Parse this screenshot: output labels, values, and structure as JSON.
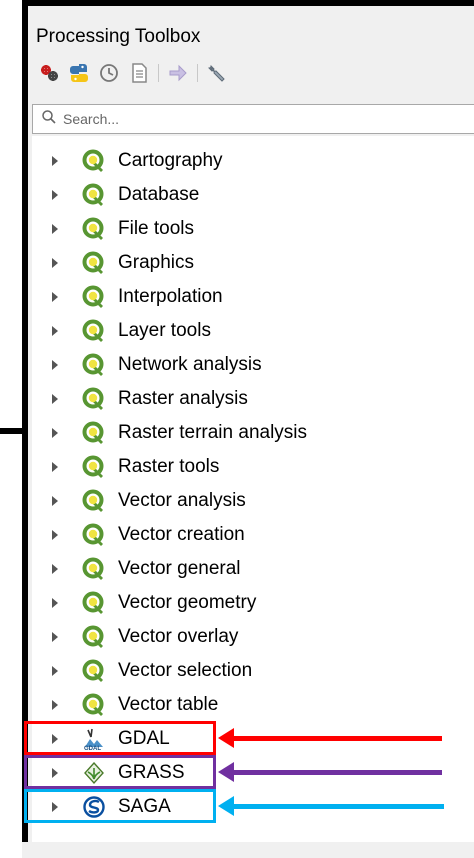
{
  "panel": {
    "title": "Processing Toolbox"
  },
  "toolbar": {
    "buttons": [
      {
        "name": "models-icon"
      },
      {
        "name": "python-scripts-icon"
      },
      {
        "name": "history-icon"
      },
      {
        "name": "results-viewer-icon"
      },
      {
        "name": "in-place-edit-icon"
      },
      {
        "name": "options-wrench-icon"
      }
    ]
  },
  "search": {
    "placeholder": "Search..."
  },
  "tree": {
    "items": [
      {
        "label": "Cartography",
        "icon": "qgis-icon"
      },
      {
        "label": "Database",
        "icon": "qgis-icon"
      },
      {
        "label": "File tools",
        "icon": "qgis-icon"
      },
      {
        "label": "Graphics",
        "icon": "qgis-icon"
      },
      {
        "label": "Interpolation",
        "icon": "qgis-icon"
      },
      {
        "label": "Layer tools",
        "icon": "qgis-icon"
      },
      {
        "label": "Network analysis",
        "icon": "qgis-icon"
      },
      {
        "label": "Raster analysis",
        "icon": "qgis-icon"
      },
      {
        "label": "Raster terrain analysis",
        "icon": "qgis-icon"
      },
      {
        "label": "Raster tools",
        "icon": "qgis-icon"
      },
      {
        "label": "Vector analysis",
        "icon": "qgis-icon"
      },
      {
        "label": "Vector creation",
        "icon": "qgis-icon"
      },
      {
        "label": "Vector general",
        "icon": "qgis-icon"
      },
      {
        "label": "Vector geometry",
        "icon": "qgis-icon"
      },
      {
        "label": "Vector overlay",
        "icon": "qgis-icon"
      },
      {
        "label": "Vector selection",
        "icon": "qgis-icon"
      },
      {
        "label": "Vector table",
        "icon": "qgis-icon"
      },
      {
        "label": "GDAL",
        "icon": "gdal-icon"
      },
      {
        "label": "GRASS",
        "icon": "grass-icon"
      },
      {
        "label": "SAGA",
        "icon": "saga-icon"
      }
    ]
  },
  "highlights": [
    {
      "target": "GDAL",
      "color": "#ff0000"
    },
    {
      "target": "GRASS",
      "color": "#7030a0"
    },
    {
      "target": "SAGA",
      "color": "#00b0f0"
    }
  ],
  "colors": {
    "qgis_green": "#589632",
    "qgis_yellow": "#f0e442",
    "frame": "#000000"
  }
}
